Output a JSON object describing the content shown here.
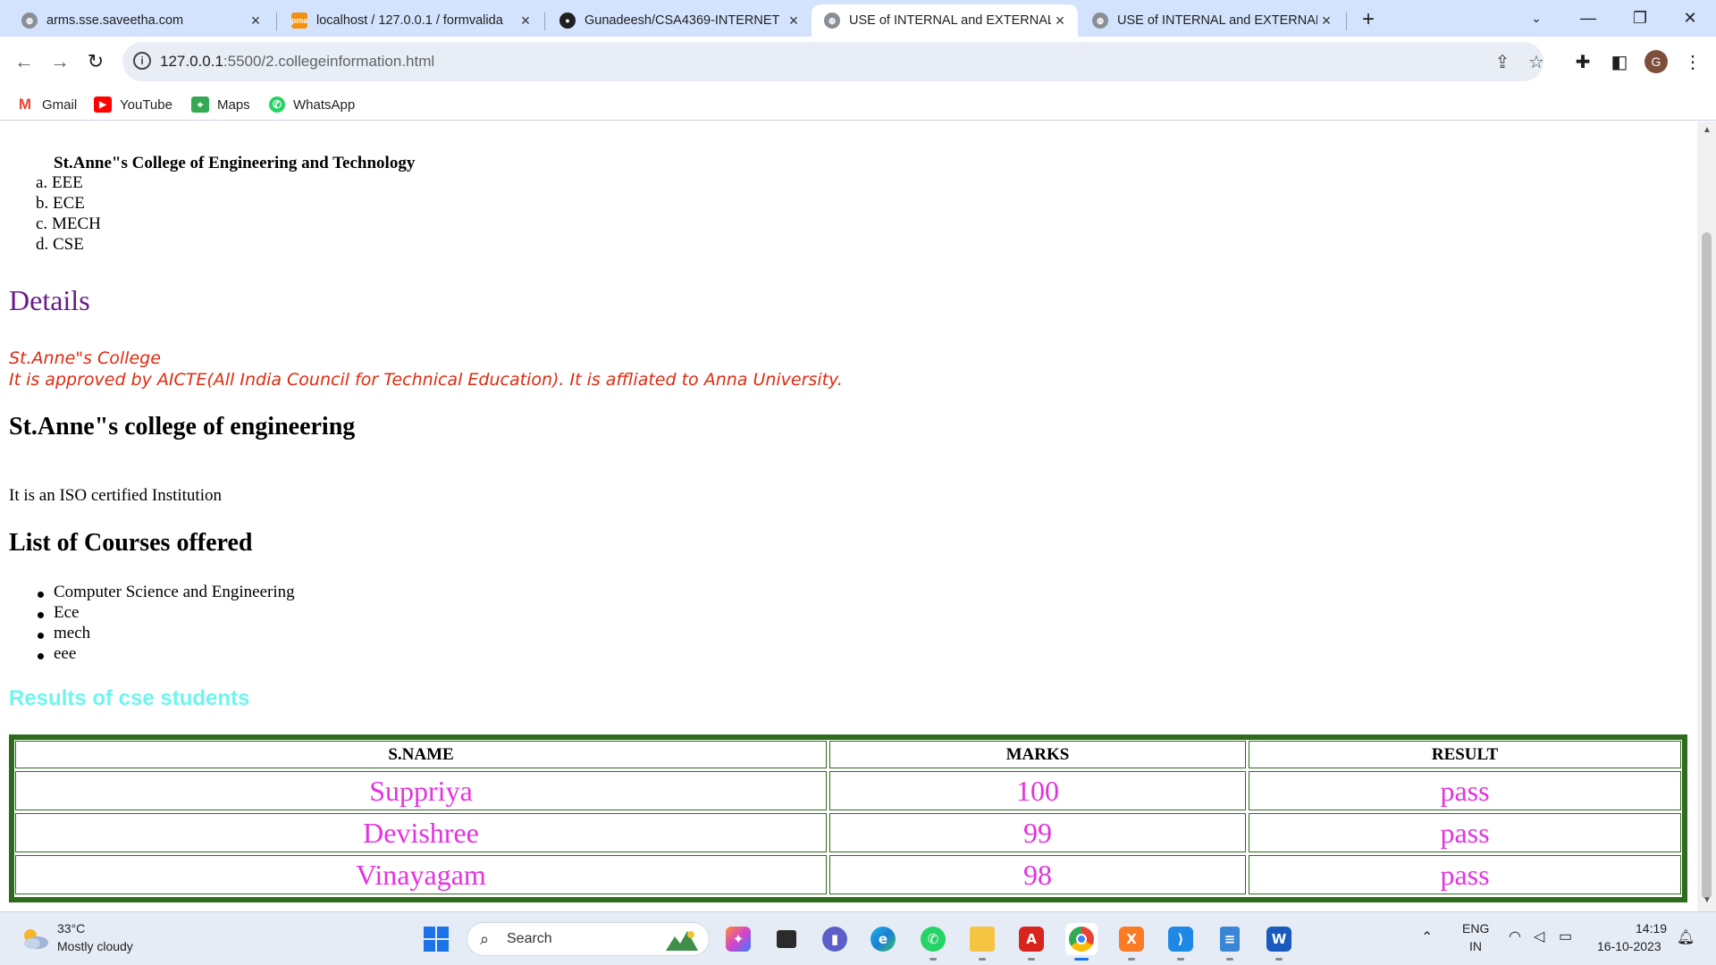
{
  "tabs": [
    {
      "title": "arms.sse.saveetha.com",
      "icon": "globe-icon",
      "color": "#5f6368"
    },
    {
      "title": "localhost / 127.0.0.1 / formvalida",
      "icon": "phpmyadmin-icon",
      "color": "#f29111"
    },
    {
      "title": "Gunadeesh/CSA4369-INTERNET",
      "icon": "github-icon",
      "color": "#1f1f1f"
    },
    {
      "title": "USE of INTERNAL and EXTERNAL",
      "icon": "globe-icon",
      "color": "#5f6368"
    },
    {
      "title": "USE of INTERNAL and EXTERNAL",
      "icon": "globe-icon",
      "color": "#5f6368"
    }
  ],
  "address_bar": {
    "url_host": "127.0.0.1",
    "url_path": ":5500/2.collegeinformation.html"
  },
  "profile_initial": "G",
  "bookmarks": [
    {
      "label": "Gmail",
      "icon": "gmail-icon"
    },
    {
      "label": "YouTube",
      "icon": "youtube-icon"
    },
    {
      "label": "Maps",
      "icon": "maps-icon"
    },
    {
      "label": "WhatsApp",
      "icon": "whatsapp-icon"
    }
  ],
  "page": {
    "college_name": "St.Anne\"s College of Engineering and Technology",
    "departments": [
      {
        "marker": "a.",
        "name": "EEE"
      },
      {
        "marker": "b.",
        "name": "ECE"
      },
      {
        "marker": "c.",
        "name": "MECH"
      },
      {
        "marker": "d.",
        "name": "CSE"
      }
    ],
    "details_heading": "Details",
    "details_line1": "St.Anne\"s College",
    "details_line2": "It is approved by AICTE(All India Council for Technical Education). It is affliated to Anna University.",
    "stanne_heading": "St.Anne\"s college of engineering",
    "iso_text": "It is an ISO certified Institution",
    "courses_heading": "List of Courses offered",
    "courses": [
      "Computer Science and Engineering",
      "Ece",
      "mech",
      "eee"
    ],
    "results_heading": "Results of cse students",
    "table": {
      "headers": [
        "S.NAME",
        "MARKS",
        "RESULT"
      ],
      "rows": [
        [
          "Suppriya",
          "100",
          "pass"
        ],
        [
          "Devishree",
          "99",
          "pass"
        ],
        [
          "Vinayagam",
          "98",
          "pass"
        ]
      ]
    }
  },
  "taskbar": {
    "weather_temp": "33°C",
    "weather_desc": "Mostly cloudy",
    "search_label": "Search",
    "lang_line1": "ENG",
    "lang_line2": "IN",
    "time": "14:19",
    "date": "16-10-2023"
  },
  "colors": {
    "details_heading": "#6a1b8a",
    "red_text": "#e02a0f",
    "results_heading": "#6ff5ee",
    "table_border": "#2e6b1c",
    "table_cell_text": "#e432e0"
  }
}
